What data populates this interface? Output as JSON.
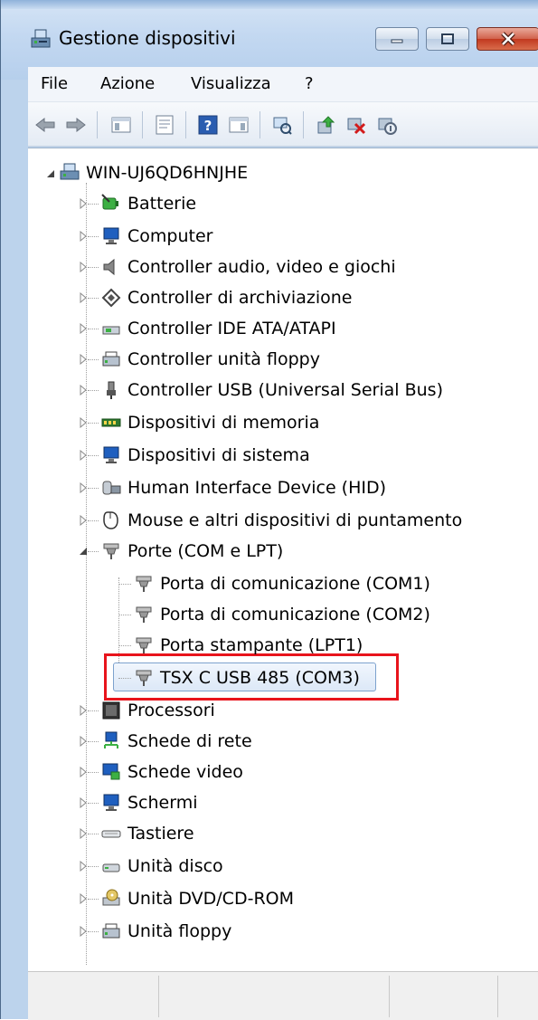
{
  "window": {
    "title": "Gestione dispositivi",
    "icon": "device-manager-icon"
  },
  "menu": [
    "File",
    "Azione",
    "Visualizza",
    "?"
  ],
  "toolbar": {
    "buttons": [
      "back-icon",
      "forward-icon",
      "show-hide-console-tree-icon",
      "properties-icon",
      "help-icon",
      "action-pane-icon",
      "scan-hardware-icon",
      "update-driver-icon",
      "uninstall-icon",
      "disable-icon"
    ]
  },
  "tree": {
    "root": "WIN-UJ6QD6HNJHE",
    "categories": [
      "Batterie",
      "Computer",
      "Controller audio, video e giochi",
      "Controller di archiviazione",
      "Controller IDE ATA/ATAPI",
      "Controller unità floppy",
      "Controller USB (Universal Serial Bus)",
      "Dispositivi di memoria",
      "Dispositivi di sistema",
      "Human Interface Device (HID)",
      "Mouse e altri dispositivi di puntamento",
      "Porte (COM e LPT)",
      "Processori",
      "Schede di rete",
      "Schede video",
      "Schermi",
      "Tastiere",
      "Unità disco",
      "Unità DVD/CD-ROM",
      "Unità floppy"
    ],
    "ports": [
      "Porta di comunicazione (COM1)",
      "Porta di comunicazione (COM2)",
      "Porta stampante (LPT1)",
      "TSX C USB 485 (COM3)"
    ],
    "selected": "TSX C USB 485 (COM3)"
  },
  "colors": {
    "highlight_box": "#e8141c",
    "selection_border": "#7da2ce"
  }
}
